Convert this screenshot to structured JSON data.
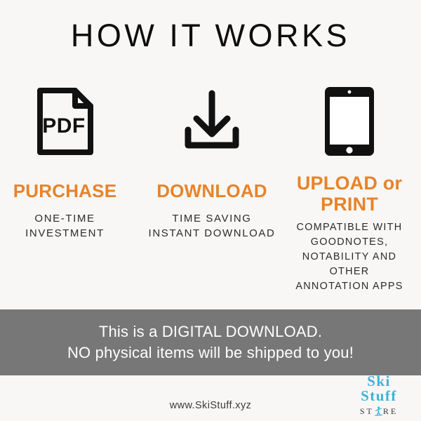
{
  "page": {
    "title": "HOW IT WORKS",
    "background_color": "#f8f7f5",
    "accent_color": "#e8832a",
    "banner_color": "#777777",
    "logo_color": "#3bb4d8"
  },
  "steps": [
    {
      "icon": "pdf-file-icon",
      "icon_label": "PDF",
      "heading": "PURCHASE",
      "description": "ONE-TIME\nINVESTMENT"
    },
    {
      "icon": "download-icon",
      "icon_label": "",
      "heading": "DOWNLOAD",
      "description": "TIME SAVING\nINSTANT DOWNLOAD"
    },
    {
      "icon": "tablet-icon",
      "icon_label": "",
      "heading": "UPLOAD or PRINT",
      "description": "COMPATIBLE WITH\nGOODNOTES,\nNOTABILITY AND\nOTHER\nANNOTATION APPS"
    }
  ],
  "banner": {
    "line1": "This is a DIGITAL DOWNLOAD.",
    "line2": "NO physical items will be shipped to you!"
  },
  "footer": {
    "url": "www.SkiStuff.xyz"
  },
  "logo": {
    "line1": "Ski",
    "line2": "Stuff",
    "store_before": "ST",
    "store_after": "RE",
    "skier_icon": "skier-icon"
  }
}
